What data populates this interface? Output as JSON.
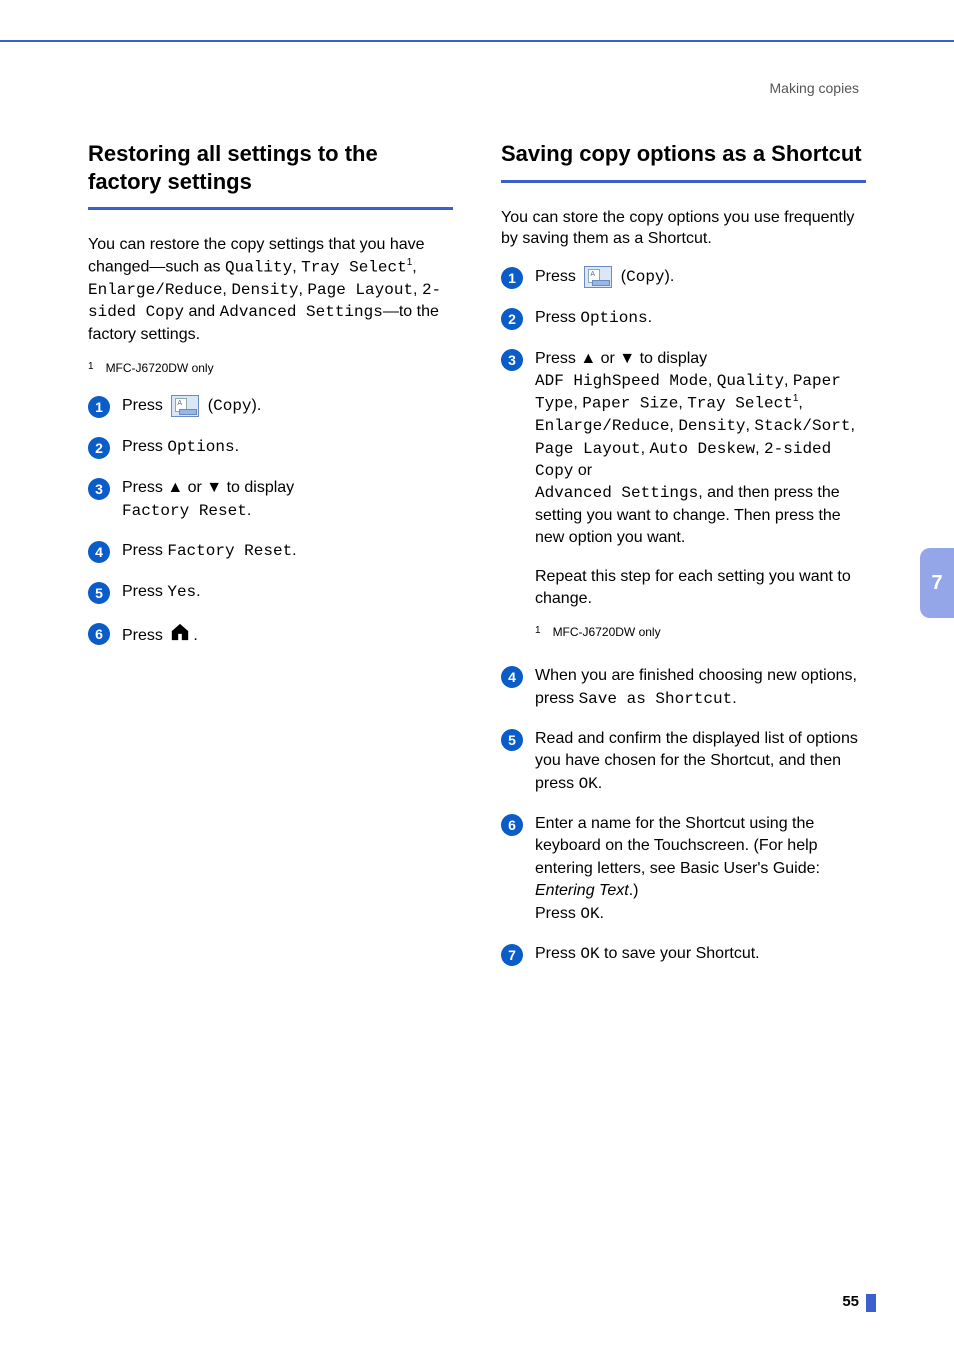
{
  "header": {
    "section_label": "Making copies"
  },
  "side_tab": "7",
  "page_number": "55",
  "left": {
    "heading": "Restoring all settings to the factory settings",
    "intro_parts": {
      "p1": "You can restore the copy settings that you have changed—such as ",
      "quality": "Quality",
      "tray_select": "Tray Select",
      "sup1": "1",
      "enlarge_reduce": "Enlarge/Reduce",
      "density": "Density",
      "page_layout": "Page Layout",
      "two_sided": "2-sided Copy",
      "and": " and ",
      "advanced": "Advanced Settings",
      "tail": "—to the factory settings."
    },
    "footnote": {
      "num": "1",
      "text": "MFC-J6720DW only"
    },
    "steps": {
      "s1": {
        "num": "1",
        "press": "Press ",
        "copy": "Copy",
        "tail": ")."
      },
      "s2": {
        "num": "2",
        "press": "Press ",
        "options": "Options",
        "tail": "."
      },
      "s3": {
        "num": "3",
        "line1": "Press ▲ or ▼ to display ",
        "factory_reset": "Factory Reset",
        "tail": "."
      },
      "s4": {
        "num": "4",
        "press": "Press ",
        "factory_reset": "Factory Reset",
        "tail": "."
      },
      "s5": {
        "num": "5",
        "press": "Press ",
        "yes": "Yes",
        "tail": "."
      },
      "s6": {
        "num": "6",
        "press": "Press ",
        "tail": "."
      }
    }
  },
  "right": {
    "heading": "Saving copy options as a Shortcut",
    "intro": "You can store the copy options you use frequently by saving them as a Shortcut.",
    "steps": {
      "s1": {
        "num": "1",
        "press": "Press ",
        "copy": "Copy",
        "tail": ")."
      },
      "s2": {
        "num": "2",
        "press": "Press ",
        "options": "Options",
        "tail": "."
      },
      "s3": {
        "num": "3",
        "line1": "Press ▲ or ▼ to display ",
        "adf": "ADF HighSpeed Mode",
        "quality": "Quality",
        "paper_type": "Paper Type",
        "paper_size": "Paper Size",
        "tray_select": "Tray Select",
        "sup1": "1",
        "enlarge_reduce": "Enlarge/Reduce",
        "density": "Density",
        "stack_sort": "Stack/Sort",
        "page_layout": "Page Layout",
        "auto_deskew": "Auto Deskew",
        "two_sided": "2-sided Copy",
        "or": " or ",
        "advanced": "Advanced Settings",
        "tail": ", and then press the setting you want to change. Then press the new option you want.",
        "repeat": "Repeat this step for each setting you want to change.",
        "footnote_num": "1",
        "footnote_text": "MFC-J6720DW only"
      },
      "s4": {
        "num": "4",
        "line": "When you are finished choosing new options, press ",
        "save": "Save as Shortcut",
        "tail": "."
      },
      "s5": {
        "num": "5",
        "line": "Read and confirm the displayed list of options you have chosen for the Shortcut, and then press ",
        "ok": "OK",
        "tail": "."
      },
      "s6": {
        "num": "6",
        "line1": "Enter a name for the Shortcut using the keyboard on the Touchscreen. (For help entering letters, see Basic User's Guide: ",
        "ital": "Entering Text",
        "line2": ".)",
        "press": "Press ",
        "ok": "OK",
        "tail": "."
      },
      "s7": {
        "num": "7",
        "press": "Press ",
        "ok": "OK",
        "tail": " to save your Shortcut."
      }
    }
  }
}
